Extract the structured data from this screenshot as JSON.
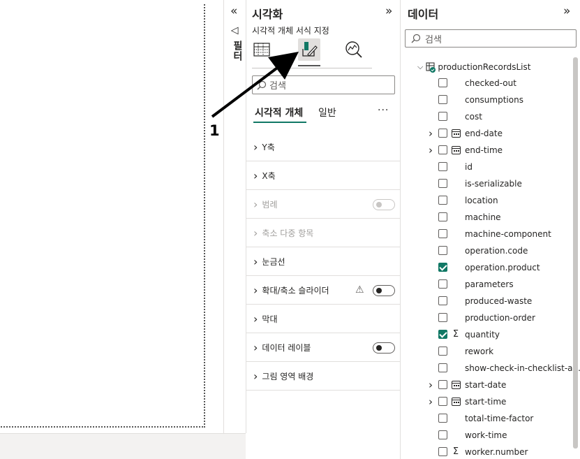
{
  "filters_strip": {
    "label": "필터",
    "expand_glyph": "«"
  },
  "visualizations": {
    "title": "시각화",
    "collapse_glyph": "»",
    "subtitle": "시각적 개체 서식 지정",
    "search_placeholder": "검색",
    "tabs": [
      {
        "label": "시각적 개체",
        "active": true
      },
      {
        "label": "일반",
        "active": false
      }
    ],
    "more_glyph": "···",
    "sections": [
      {
        "label": "Y축",
        "disabled": false,
        "toggle": null,
        "warning": false
      },
      {
        "label": "X축",
        "disabled": false,
        "toggle": null,
        "warning": false
      },
      {
        "label": "범례",
        "disabled": true,
        "toggle": "off",
        "warning": false
      },
      {
        "label": "축소 다중 항목",
        "disabled": true,
        "toggle": null,
        "warning": false
      },
      {
        "label": "눈금선",
        "disabled": false,
        "toggle": null,
        "warning": false
      },
      {
        "label": "확대/축소 슬라이더",
        "disabled": false,
        "toggle": "off",
        "warning": true
      },
      {
        "label": "막대",
        "disabled": false,
        "toggle": null,
        "warning": false
      },
      {
        "label": "데이터 레이블",
        "disabled": false,
        "toggle": "off",
        "warning": false
      },
      {
        "label": "그림 영역 배경",
        "disabled": false,
        "toggle": null,
        "warning": false
      }
    ]
  },
  "data_pane": {
    "title": "데이터",
    "collapse_glyph": "»",
    "search_placeholder": "검색",
    "table_name": "productionRecordsList",
    "fields": [
      {
        "name": "checked-out",
        "checked": false,
        "icon": "",
        "expandable": false
      },
      {
        "name": "consumptions",
        "checked": false,
        "icon": "",
        "expandable": false
      },
      {
        "name": "cost",
        "checked": false,
        "icon": "",
        "expandable": false
      },
      {
        "name": "end-date",
        "checked": false,
        "icon": "calendar",
        "expandable": true
      },
      {
        "name": "end-time",
        "checked": false,
        "icon": "calendar",
        "expandable": true
      },
      {
        "name": "id",
        "checked": false,
        "icon": "",
        "expandable": false
      },
      {
        "name": "is-serializable",
        "checked": false,
        "icon": "",
        "expandable": false
      },
      {
        "name": "location",
        "checked": false,
        "icon": "",
        "expandable": false
      },
      {
        "name": "machine",
        "checked": false,
        "icon": "",
        "expandable": false
      },
      {
        "name": "machine-component",
        "checked": false,
        "icon": "",
        "expandable": false
      },
      {
        "name": "operation.code",
        "checked": false,
        "icon": "",
        "expandable": false
      },
      {
        "name": "operation.product",
        "checked": true,
        "icon": "",
        "expandable": false
      },
      {
        "name": "parameters",
        "checked": false,
        "icon": "",
        "expandable": false
      },
      {
        "name": "produced-waste",
        "checked": false,
        "icon": "",
        "expandable": false
      },
      {
        "name": "production-order",
        "checked": false,
        "icon": "",
        "expandable": false
      },
      {
        "name": "quantity",
        "checked": true,
        "icon": "sigma",
        "expandable": false
      },
      {
        "name": "rework",
        "checked": false,
        "icon": "",
        "expandable": false
      },
      {
        "name": "show-check-in-checklist-an...",
        "checked": false,
        "icon": "",
        "expandable": false
      },
      {
        "name": "start-date",
        "checked": false,
        "icon": "calendar",
        "expandable": true
      },
      {
        "name": "start-time",
        "checked": false,
        "icon": "calendar",
        "expandable": true
      },
      {
        "name": "total-time-factor",
        "checked": false,
        "icon": "",
        "expandable": false
      },
      {
        "name": "work-time",
        "checked": false,
        "icon": "",
        "expandable": false
      },
      {
        "name": "worker.number",
        "checked": false,
        "icon": "sigma",
        "expandable": false
      }
    ]
  },
  "annotation": {
    "label": "1"
  },
  "colors": {
    "accent": "#117865",
    "active_tab_bg": "#e1dfdd",
    "border": "#e1dfdd"
  }
}
